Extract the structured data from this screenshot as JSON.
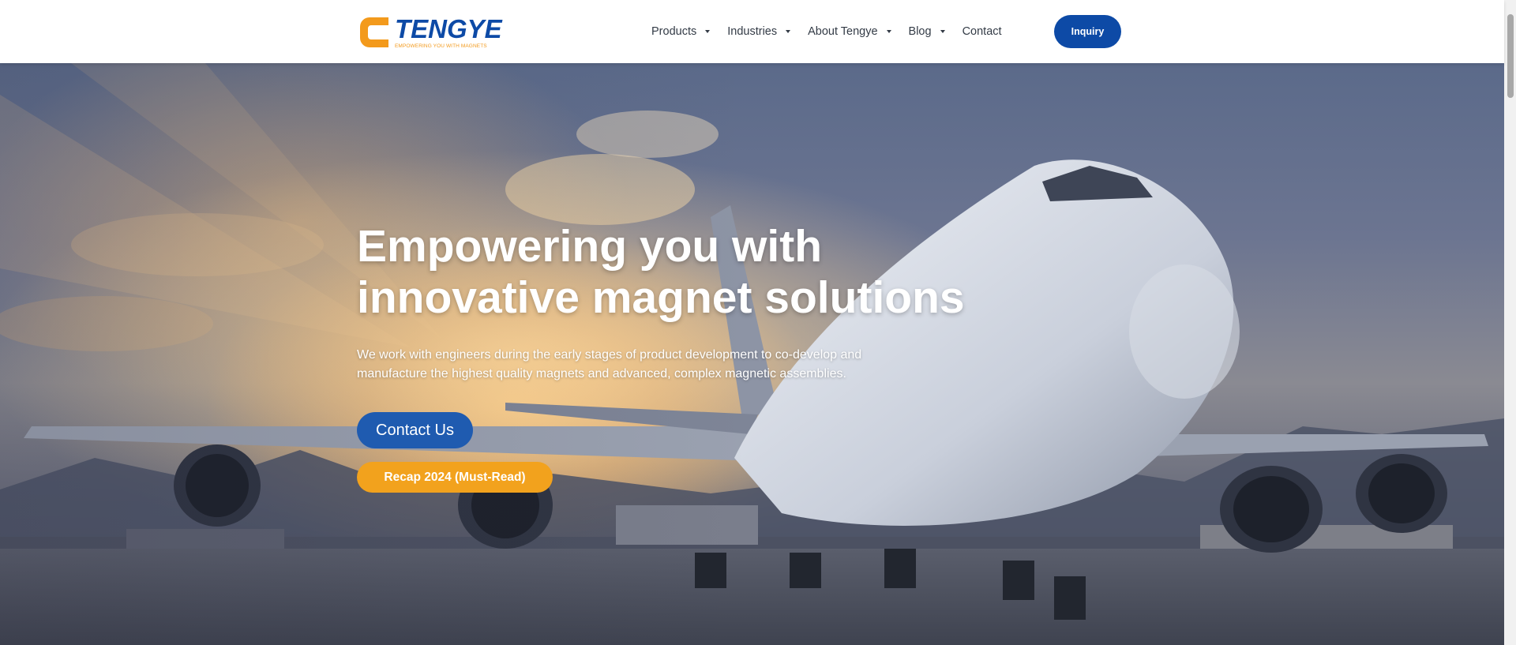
{
  "brand": {
    "name": "TENGYE",
    "tagline": "EMPOWERING YOU WITH MAGNETS",
    "colors": {
      "primary": "#0d4aa6",
      "accent": "#f39a1c"
    }
  },
  "nav": {
    "items": [
      {
        "label": "Products",
        "dropdown": true
      },
      {
        "label": "Industries",
        "dropdown": true
      },
      {
        "label": "About Tengye",
        "dropdown": true
      },
      {
        "label": "Blog",
        "dropdown": true
      },
      {
        "label": "Contact",
        "dropdown": false
      }
    ],
    "inquiry_label": "Inquiry"
  },
  "hero": {
    "title_line1": "Empowering you with",
    "title_line2": "innovative magnet solutions",
    "subtitle": "We work with engineers during the early stages of product development to co-develop and manufacture the highest quality magnets and advanced, complex magnetic assemblies.",
    "contact_label": "Contact Us",
    "recap_label": "Recap 2024 (Must-Read)",
    "background_image": "airplane-at-sunset"
  }
}
